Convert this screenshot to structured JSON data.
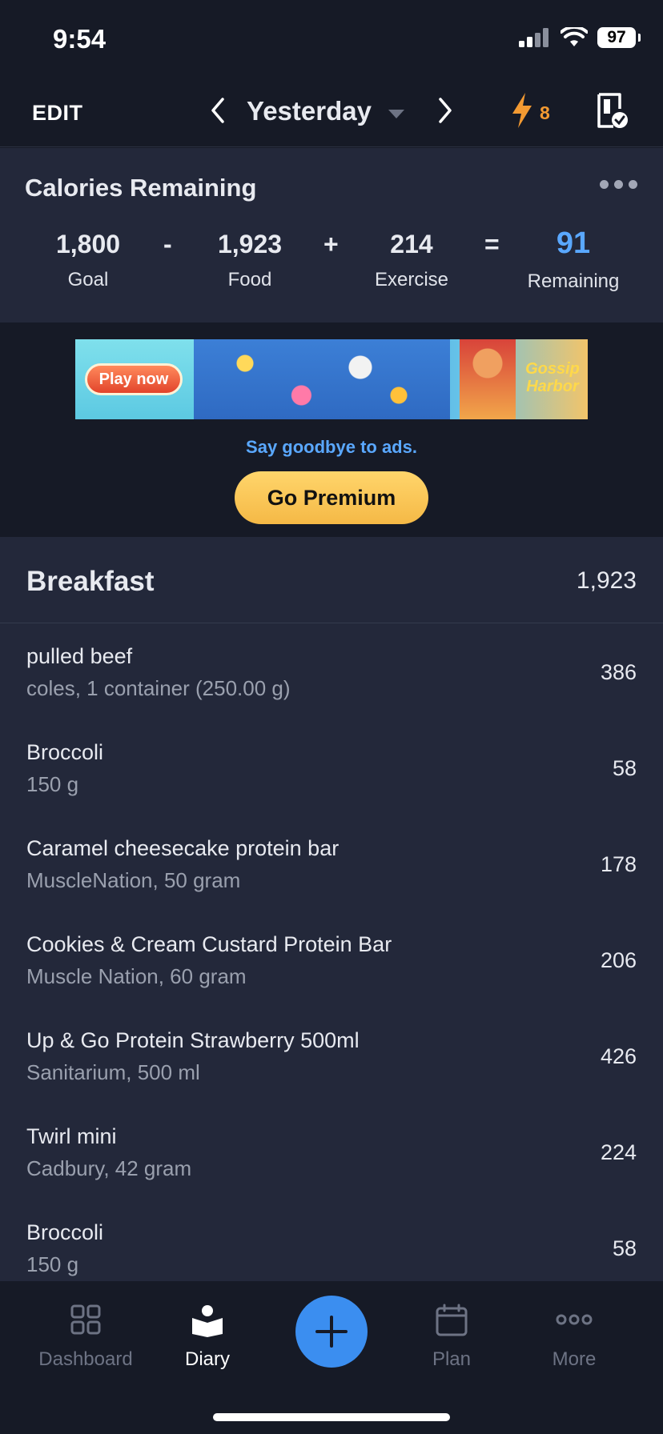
{
  "status_bar": {
    "time": "9:54",
    "battery": "97"
  },
  "nav": {
    "edit_label": "EDIT",
    "date_label": "Yesterday",
    "streak_count": "8"
  },
  "calories": {
    "title": "Calories Remaining",
    "goal_value": "1,800",
    "goal_label": "Goal",
    "minus": "-",
    "food_value": "1,923",
    "food_label": "Food",
    "plus": "+",
    "exercise_value": "214",
    "exercise_label": "Exercise",
    "equals": "=",
    "remaining_value": "91",
    "remaining_label": "Remaining"
  },
  "ad": {
    "play_label": "Play now",
    "brand": "Gossip Harbor",
    "goodbye": "Say goodbye to ads.",
    "premium_label": "Go Premium"
  },
  "meal": {
    "title": "Breakfast",
    "total": "1,923",
    "items": [
      {
        "name": "pulled beef",
        "desc": "coles, 1 container (250.00 g)",
        "cal": "386"
      },
      {
        "name": "Broccoli",
        "desc": "150 g",
        "cal": "58"
      },
      {
        "name": "Caramel cheesecake protein bar",
        "desc": "MuscleNation, 50 gram",
        "cal": "178"
      },
      {
        "name": "Cookies & Cream Custard Protein Bar",
        "desc": "Muscle Nation, 60 gram",
        "cal": "206"
      },
      {
        "name": "Up & Go Protein Strawberry 500ml",
        "desc": "Sanitarium, 500 ml",
        "cal": "426"
      },
      {
        "name": "Twirl mini",
        "desc": "Cadbury, 42 gram",
        "cal": "224"
      },
      {
        "name": "Broccoli",
        "desc": "150 g",
        "cal": "58"
      }
    ]
  },
  "tabs": [
    {
      "label": "Dashboard",
      "icon": "dashboard-icon"
    },
    {
      "label": "Diary",
      "icon": "diary-icon"
    },
    {
      "label": "Plan",
      "icon": "calendar-icon"
    },
    {
      "label": "More",
      "icon": "more-icon"
    }
  ],
  "colors": {
    "accent_blue": "#3b8ef0",
    "remaining_blue": "#5aa8ff",
    "streak_orange": "#f39a32",
    "premium_yellow": "#ffd56b"
  }
}
